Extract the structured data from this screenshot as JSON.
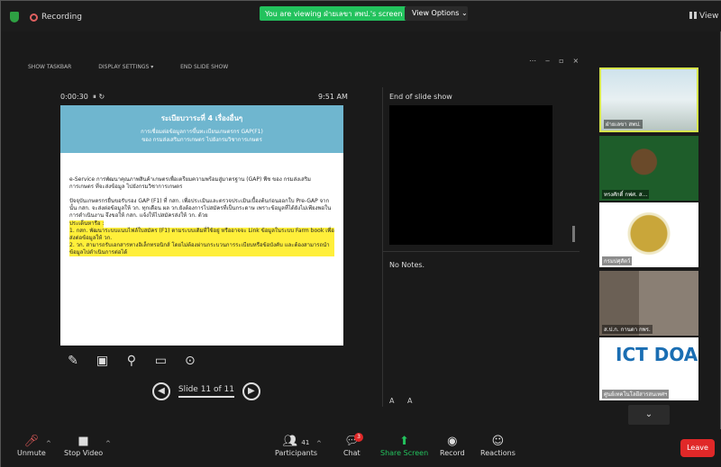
{
  "topbar": {
    "recording_label": "Recording",
    "viewing_banner": "You are viewing ฝ่ายเลขา สพป.'s screen",
    "view_options_label": "View Options ⌄",
    "view_label": "View"
  },
  "presenter": {
    "show_taskbar": "SHOW TASKBAR",
    "display_settings": "DISPLAY SETTINGS ▾",
    "end_slide_show": "END SLIDE SHOW",
    "timer": "0:00:30",
    "clock": "9:51 AM",
    "slide_counter": "Slide 11 of 11",
    "end_label": "End of slide show",
    "notes": "No Notes.",
    "font_up": "A",
    "font_down": "A"
  },
  "slide": {
    "title": "ระเบียบวาระที่ 4 เรื่องอื่นๆ",
    "subtitle_1": "การเชื่อมต่อข้อมูลการขึ้นทะเบียนเกษตรกร GAP(F1)",
    "subtitle_2": "ของ กรมส่งเสริมการเกษตร ไปยังกรมวิชาการเกษตร",
    "para_1": "e-Service การพัฒนาคุณภาพสินค้าเกษตรเพื่อเตรียมความพร้อมสู่มาตรฐาน (GAP) พืช ของ กรมส่งเสริมการเกษตร ที่จะส่งข้อมูล ไปยังกรมวิชาการเกษตร",
    "para_2": "ปัจจุบันเกษตรกรยื่นขอรับรอง GAP (F1) ที่ กสก. เพื่อประเมินและตรวจประเมินเบื้องต้นก่อนออกใบ Pre-GAP จากนั้น กสก. จะส่งต่อข้อมูลให้ วก. ทุกเดือน ผล วก.ยังต้องการไปสมัครที่เป็นกระดาษ เพราะข้อมูลที่ได้ยังไม่เพียงพอในการดำเนินงาน จึงขอให้ กสก. แจ้งให้ไปสมัครส่งให้ วก. ด้วย",
    "hl_1": "ประเด็นหารือ :",
    "hl_2": "1. กสก. พัฒนาระบบแนบไฟล์ใบสมัคร (F1) ตามระบบเดิมที่ใช้อยู่ หรืออาจจะ Link ข้อมูลในระบบ Farm book เพื่อส่งต่อข้อมูลให้ วก.",
    "hl_3": "2. วก. สามารถรับเอกสารทางอิเล็กทรอนิกส์ โดยไม่ต้องผ่านกระบวนการระเบียบหรือข้อบังคับ และต้องสามารถนำข้อมูลไปดำเนินการต่อได้"
  },
  "participants": [
    {
      "name": "ฝ่ายเลขา สพป."
    },
    {
      "name": "ทรงศักดิ์ กฟศ. ส..."
    },
    {
      "name": "กรมปศุสัตว์"
    },
    {
      "name": "ส.ป.ก. กานดา กพร."
    },
    {
      "name": "ศูนย์เทคโนโลยีสารสนเทศฯ",
      "logo_text": "ICT DOA"
    }
  ],
  "bottombar": {
    "unmute": "Unmute",
    "stop_video": "Stop Video",
    "participants": "Participants",
    "participant_count": "41",
    "chat": "Chat",
    "chat_badge": "3",
    "share_screen": "Share Screen",
    "record": "Record",
    "reactions": "Reactions",
    "leave": "Leave"
  },
  "colors": {
    "accent_green": "#23c25d",
    "leave_red": "#e02828",
    "slide_header": "#6fb6cf",
    "highlight": "#ffef3a"
  }
}
